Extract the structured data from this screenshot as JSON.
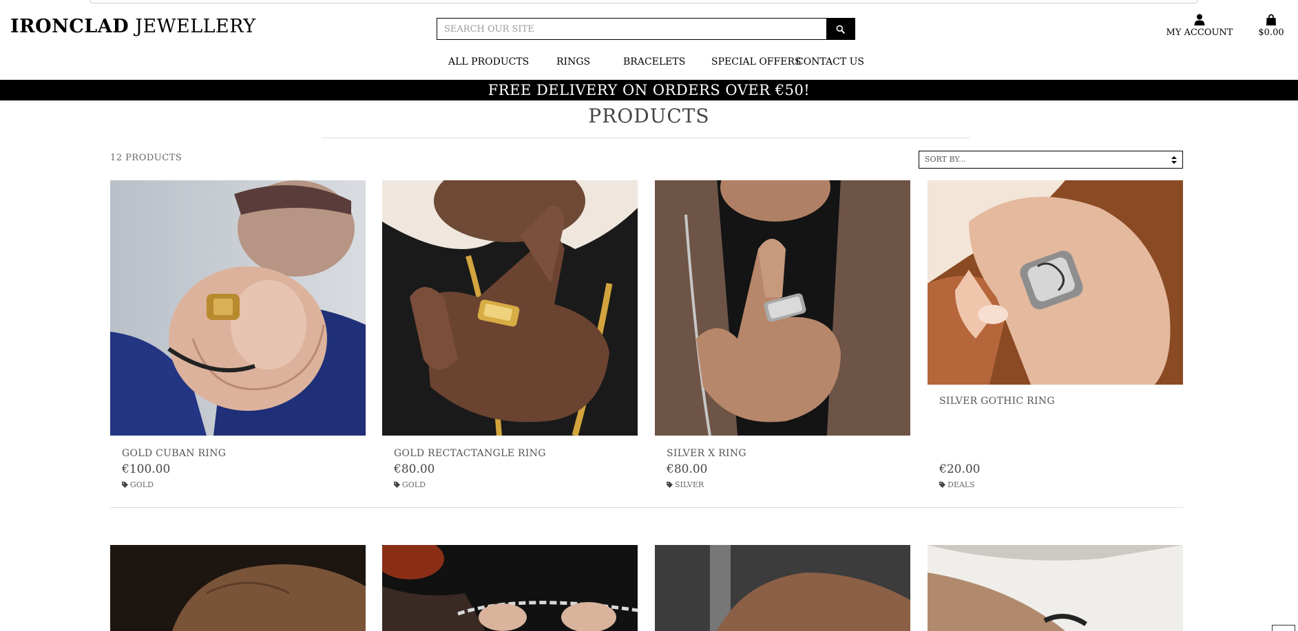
{
  "brand": {
    "name_bold": "IRONCLAD",
    "name_light": "JEWELLERY"
  },
  "search": {
    "placeholder": "SEARCH OUR SITE",
    "icon": "search-icon"
  },
  "account": {
    "label": "MY ACCOUNT",
    "icon": "user-icon"
  },
  "cart": {
    "total": "$0.00",
    "icon": "shopping-bag-icon"
  },
  "nav": [
    {
      "label": "ALL PRODUCTS"
    },
    {
      "label": "RINGS"
    },
    {
      "label": "BRACELETS"
    },
    {
      "label": "SPECIAL OFFERS"
    },
    {
      "label": "CONTACT US"
    }
  ],
  "banner": {
    "text": "FREE DELIVERY ON ORDERS OVER €50!"
  },
  "page": {
    "title": "PRODUCTS",
    "count": "12 PRODUCTS",
    "sort_placeholder": "SORT BY..."
  },
  "products": [
    {
      "name": "GOLD CUBAN RING",
      "price": "€100.00",
      "category": "GOLD",
      "icon": "tag-icon"
    },
    {
      "name": "GOLD RECTACTANGLE RING",
      "price": "€80.00",
      "category": "GOLD",
      "icon": "tag-icon"
    },
    {
      "name": "SILVER X RING",
      "price": "€80.00",
      "category": "SILVER",
      "icon": "tag-icon"
    },
    {
      "name": "SILVER GOTHIC RING",
      "price": "€20.00",
      "category": "DEALS",
      "icon": "tag-icon"
    }
  ],
  "colors": {
    "banner_bg": "#000000",
    "banner_text": "#ffffff",
    "text_muted": "#555555"
  }
}
